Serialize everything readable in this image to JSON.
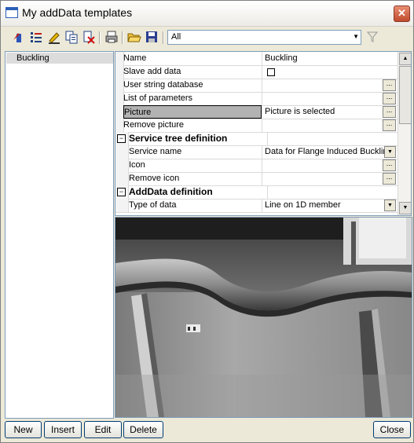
{
  "window": {
    "title": "My addData templates"
  },
  "toolbar": {
    "filter_value": "All"
  },
  "tree": {
    "items": [
      "Buckling"
    ]
  },
  "grid": {
    "rows": [
      {
        "label": "Name",
        "value": "Buckling"
      },
      {
        "label": "Slave add data",
        "value": ""
      },
      {
        "label": "User string database",
        "value": ""
      },
      {
        "label": "List of parameters",
        "value": ""
      },
      {
        "label": "Picture",
        "value": "Picture is selected"
      },
      {
        "label": "Remove picture",
        "value": ""
      },
      {
        "label": "Service tree definition",
        "value": ""
      },
      {
        "label": "Service name",
        "value": "Data for Flange Induced Buckling"
      },
      {
        "label": "Icon",
        "value": ""
      },
      {
        "label": "Remove icon",
        "value": ""
      },
      {
        "label": "AddData definition",
        "value": ""
      },
      {
        "label": "Type of data",
        "value": "Line on 1D member"
      }
    ],
    "ellipsis": "..."
  },
  "buttons": {
    "new": "New",
    "insert": "Insert",
    "edit": "Edit",
    "delete": "Delete",
    "close": "Close"
  }
}
